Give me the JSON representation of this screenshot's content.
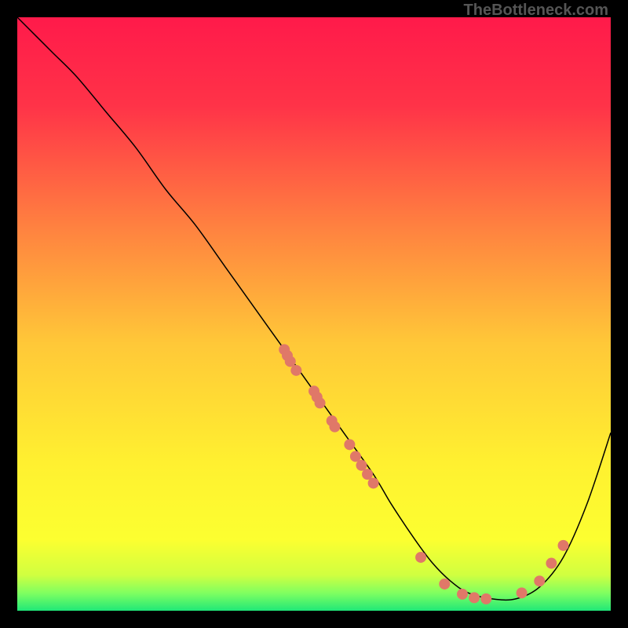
{
  "watermark": "TheBottleneck.com",
  "chart_data": {
    "type": "line",
    "title": "",
    "xlabel": "",
    "ylabel": "",
    "xlim": [
      0,
      100
    ],
    "ylim": [
      0,
      100
    ],
    "background_gradient": {
      "stops": [
        {
          "offset": 0.0,
          "color": "#ff1a4a"
        },
        {
          "offset": 0.15,
          "color": "#ff3348"
        },
        {
          "offset": 0.35,
          "color": "#ff8040"
        },
        {
          "offset": 0.55,
          "color": "#ffc838"
        },
        {
          "offset": 0.75,
          "color": "#fff030"
        },
        {
          "offset": 0.88,
          "color": "#fcff30"
        },
        {
          "offset": 0.94,
          "color": "#d0ff40"
        },
        {
          "offset": 0.97,
          "color": "#80ff60"
        },
        {
          "offset": 1.0,
          "color": "#20e878"
        }
      ]
    },
    "series": [
      {
        "name": "curve",
        "color": "#000000",
        "stroke_width": 1.5,
        "x": [
          0,
          3,
          6,
          10,
          15,
          20,
          25,
          30,
          35,
          40,
          45,
          50,
          55,
          60,
          63,
          67,
          70,
          73,
          76,
          80,
          84,
          88,
          92,
          96,
          100
        ],
        "y": [
          100,
          97,
          94,
          90,
          84,
          78,
          71,
          65,
          58,
          51,
          44,
          37,
          30,
          23,
          18,
          12,
          8,
          5,
          3,
          2,
          2,
          4,
          9,
          18,
          30
        ]
      }
    ],
    "scatter_points": {
      "color": "#e07868",
      "radius": 7,
      "points": [
        {
          "x": 45,
          "y": 44
        },
        {
          "x": 45.5,
          "y": 43
        },
        {
          "x": 46,
          "y": 42
        },
        {
          "x": 47,
          "y": 40.5
        },
        {
          "x": 50,
          "y": 37
        },
        {
          "x": 50.5,
          "y": 36
        },
        {
          "x": 51,
          "y": 35
        },
        {
          "x": 53,
          "y": 32
        },
        {
          "x": 53.5,
          "y": 31
        },
        {
          "x": 56,
          "y": 28
        },
        {
          "x": 57,
          "y": 26
        },
        {
          "x": 58,
          "y": 24.5
        },
        {
          "x": 59,
          "y": 23
        },
        {
          "x": 60,
          "y": 21.5
        },
        {
          "x": 68,
          "y": 9
        },
        {
          "x": 72,
          "y": 4.5
        },
        {
          "x": 75,
          "y": 2.8
        },
        {
          "x": 77,
          "y": 2.2
        },
        {
          "x": 79,
          "y": 2
        },
        {
          "x": 85,
          "y": 3
        },
        {
          "x": 88,
          "y": 5
        },
        {
          "x": 90,
          "y": 8
        },
        {
          "x": 92,
          "y": 11
        }
      ]
    }
  }
}
